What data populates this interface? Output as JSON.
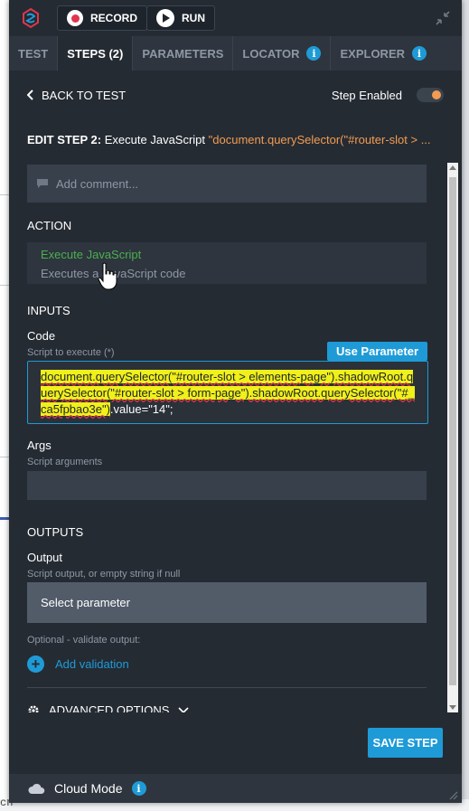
{
  "toolbar": {
    "record_label": "RECORD",
    "run_label": "RUN"
  },
  "tabs": [
    {
      "label": "TEST",
      "active": false
    },
    {
      "label": "STEPS (2)",
      "active": true
    },
    {
      "label": "PARAMETERS",
      "active": false
    },
    {
      "label": "LOCATOR",
      "active": false
    },
    {
      "label": "EXPLORER",
      "active": false
    }
  ],
  "header": {
    "back_label": "BACK TO TEST",
    "step_enabled_label": "Step Enabled",
    "step_enabled": true
  },
  "edit_step": {
    "label": "EDIT STEP 2:",
    "action": "Execute JavaScript",
    "argument": "\"document.querySelector(\"#router-slot > ..."
  },
  "comment": {
    "placeholder": "Add comment..."
  },
  "action_section": {
    "heading": "ACTION",
    "name": "Execute JavaScript",
    "description": "Executes a JavaScript code"
  },
  "inputs_section": {
    "heading": "INPUTS",
    "code_label": "Code",
    "code_sub": "Script to execute (*)",
    "use_parameter_label": "Use Parameter",
    "code_highlighted": "document.querySelector(\"#router-slot > elements-page\").shadowRoot.querySelector(\"#router-slot > form-page\").shadowRoot.querySelector(\"#_ca5fpbao3e\")",
    "code_rest": ".value=\"14\";",
    "args_label": "Args",
    "args_sub": "Script arguments"
  },
  "outputs_section": {
    "heading": "OUTPUTS",
    "output_label": "Output",
    "output_sub": "Script output, or empty string if null",
    "select_parameter_label": "Select parameter",
    "optional_label": "Optional - validate output:",
    "add_validation_label": "Add validation"
  },
  "advanced_options_label": "ADVANCED OPTIONS",
  "save_step_label": "SAVE STEP",
  "footer": {
    "cloud_mode_label": "Cloud Mode"
  },
  "colors": {
    "accent": "#1e9bd7",
    "action_green": "#4caf50",
    "highlight_orange": "#f29c52",
    "panel_bg": "#252b33"
  },
  "icons": [
    "logo-icon",
    "record-icon",
    "play-icon",
    "collapse-icon",
    "info-icon",
    "chevron-left-icon",
    "comment-icon",
    "plus-icon",
    "gear-icon",
    "chevron-down-icon",
    "cloud-icon",
    "resize-grip-icon",
    "hand-cursor-icon"
  ]
}
